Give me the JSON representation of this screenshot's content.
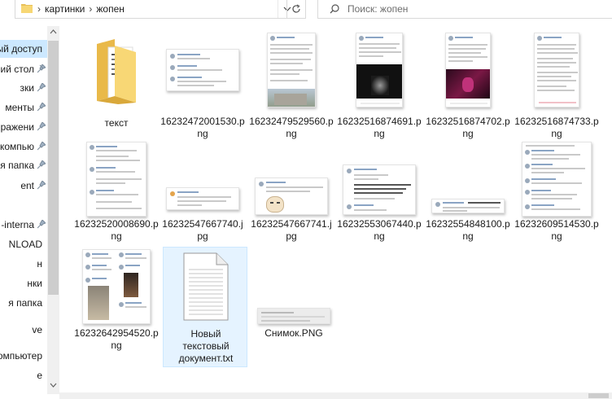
{
  "address": {
    "crumbs": [
      "картинки",
      "жопен"
    ]
  },
  "search": {
    "placeholder": "Поиск: жопен"
  },
  "nav": {
    "items": [
      {
        "label": "ый доступ",
        "pinned": false,
        "selected": true
      },
      {
        "label": "чий стол",
        "pinned": true
      },
      {
        "label": "зки",
        "pinned": true
      },
      {
        "label": "менты",
        "pinned": true
      },
      {
        "label": "ражени",
        "pinned": true
      },
      {
        "label": "компью",
        "pinned": true
      },
      {
        "label": "я папка",
        "pinned": true
      },
      {
        "label": "ent",
        "pinned": true
      },
      {
        "label": "-interna",
        "pinned": true
      },
      {
        "label": "NLOAD",
        "pinned": false
      },
      {
        "label": "н",
        "pinned": false
      },
      {
        "label": "нки",
        "pinned": false
      },
      {
        "label": "я папка",
        "pinned": false
      },
      {
        "label": "ve",
        "pinned": false
      },
      {
        "label": "омпьютер",
        "pinned": false
      },
      {
        "label": "е",
        "pinned": false
      }
    ]
  },
  "files": [
    {
      "name": "текст",
      "kind": "folder"
    },
    {
      "name": "16232472001530.png",
      "kind": "chat"
    },
    {
      "name": "16232479529560.png",
      "kind": "post-building"
    },
    {
      "name": "16232516874691.png",
      "kind": "post-dark"
    },
    {
      "name": "16232516874702.png",
      "kind": "post-pink"
    },
    {
      "name": "16232516874733.png",
      "kind": "post-text"
    },
    {
      "name": "16232520008690.png",
      "kind": "tall-text"
    },
    {
      "name": "16232547667740.jpg",
      "kind": "chat-small"
    },
    {
      "name": "16232547667741.jpg",
      "kind": "chat-meme"
    },
    {
      "name": "16232553067440.png",
      "kind": "chat-tall"
    },
    {
      "name": "16232554848100.png",
      "kind": "wide-small"
    },
    {
      "name": "16232609514530.png",
      "kind": "tall-text"
    },
    {
      "name": "16232642954520.png",
      "kind": "chat-photos"
    },
    {
      "name": "Новый текстовый документ.txt",
      "kind": "txt",
      "selected": true
    },
    {
      "name": "Снимок.PNG",
      "kind": "wide-gray"
    }
  ]
}
